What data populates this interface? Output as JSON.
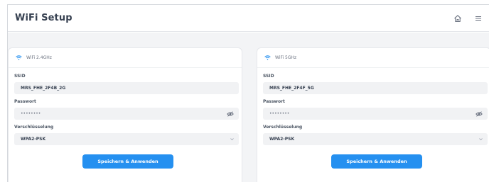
{
  "app": {
    "title": "WiFi Setup"
  },
  "header": {
    "home_icon": "home-icon",
    "menu_icon": "menu-icon"
  },
  "colors": {
    "accent": "#2590f0",
    "field_bg": "#f1f2f4",
    "page_bg": "#f3f4f6"
  },
  "networks": [
    {
      "band_label": "WiFi 2.4GHz",
      "ssid_label": "SSID",
      "ssid_value": "MRS_FHE_2F4B_2G",
      "password_label": "Passwort",
      "password_value": "••••••••",
      "encryption_label": "Verschlüsselung",
      "encryption_value": "WPA2-PSK",
      "save_label": "Speichern & Anwenden"
    },
    {
      "band_label": "WiFi 5GHz",
      "ssid_label": "SSID",
      "ssid_value": "MRS_FHE_2F4F_5G",
      "password_label": "Passwort",
      "password_value": "••••••••",
      "encryption_label": "Verschlüsselung",
      "encryption_value": "WPA2-PSK",
      "save_label": "Speichern & Anwenden"
    }
  ]
}
